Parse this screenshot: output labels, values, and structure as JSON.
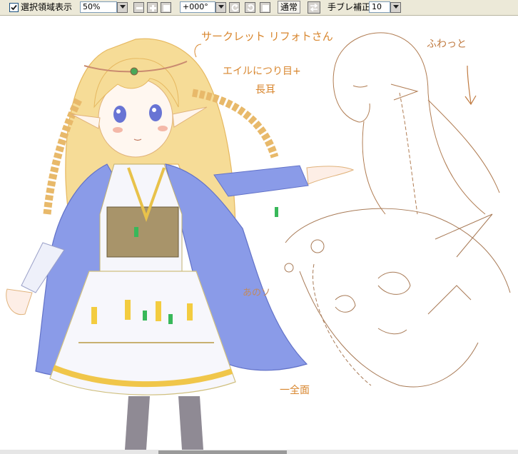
{
  "toolbar": {
    "selection_checkbox_checked": true,
    "selection_label": "選択領域表示",
    "zoom_value": "50%",
    "rotation_value": "+000°",
    "blend_mode": "通常",
    "stabilizer_label": "手ブレ補正",
    "stabilizer_value": "10"
  },
  "canvas": {
    "annotations": {
      "name_note": "サークレット リフォトさん",
      "note_line2": "エイルにつり目+",
      "note_line3": "長耳",
      "fuwatto": "ふわっと",
      "ano": "あのソ",
      "ichimai": "一全面"
    }
  }
}
